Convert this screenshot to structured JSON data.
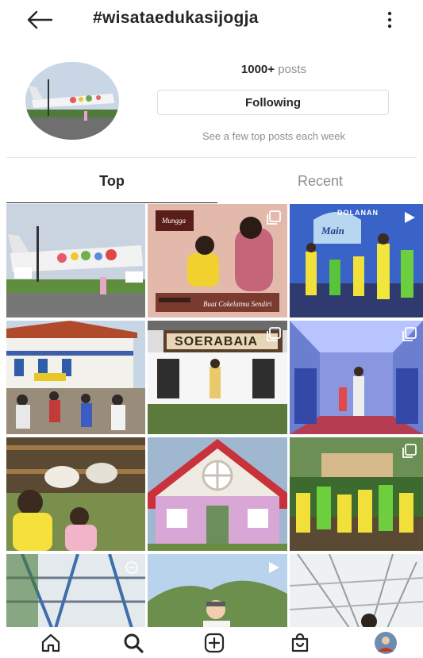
{
  "header": {
    "title": "#wisataedukasijogja",
    "back_icon": "arrow-left-icon",
    "more_icon": "vertical-dots-icon"
  },
  "profile": {
    "posts_count": "1000+",
    "posts_label": "posts",
    "follow_button_label": "Following",
    "hint": "See a few top posts each week"
  },
  "tabs": [
    {
      "label": "Top",
      "active": true
    },
    {
      "label": "Recent",
      "active": false
    }
  ],
  "grid": {
    "overlay_texts": {
      "brand": "Mungga",
      "caption": "Buat Cokelatmu Sendiri",
      "banner": "DOLANAN",
      "banner_sub": "Main",
      "station_sign": "SOERABAIA"
    }
  },
  "navbar": {
    "items": [
      "home-icon",
      "search-icon",
      "new-post-icon",
      "shop-icon",
      "profile-avatar"
    ]
  },
  "colors": {
    "text_primary": "#262626",
    "text_secondary": "#8e8e8e",
    "border": "#dbdbdb"
  }
}
